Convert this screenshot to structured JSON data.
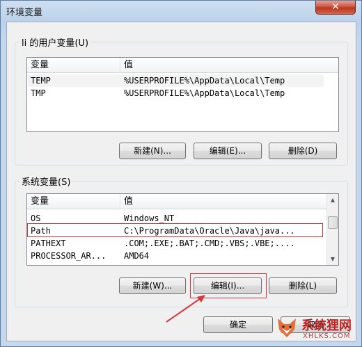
{
  "window": {
    "title": "环境变量",
    "close_glyph": "✕"
  },
  "user_vars": {
    "group_label": "li 的用户变量(U)",
    "columns": [
      "变量",
      "值"
    ],
    "rows": [
      {
        "name": "TEMP",
        "value": "%USERPROFILE%\\AppData\\Local\\Temp"
      },
      {
        "name": "TMP",
        "value": "%USERPROFILE%\\AppData\\Local\\Temp"
      }
    ],
    "buttons": {
      "new": "新建(N)...",
      "edit": "编辑(E)...",
      "delete": "删除(D)"
    }
  },
  "system_vars": {
    "group_label": "系统变量(S)",
    "columns": [
      "变量",
      "值"
    ],
    "rows": [
      {
        "name": "OS",
        "value": "Windows_NT"
      },
      {
        "name": "Path",
        "value": "C:\\ProgramData\\Oracle\\Java\\java..."
      },
      {
        "name": "PATHEXT",
        "value": ".COM;.EXE;.BAT;.CMD;.VBS;.VBE;...."
      },
      {
        "name": "PROCESSOR_AR...",
        "value": "AMD64"
      }
    ],
    "buttons": {
      "new": "新建(W)...",
      "edit": "编辑(I)...",
      "delete": "删除(L)"
    }
  },
  "dialog_buttons": {
    "ok": "确定",
    "cancel": "取消"
  },
  "watermark": {
    "name": "系统狸网",
    "site": "XHLKS.COM",
    "icon": "fox-icon"
  },
  "colors": {
    "highlight_box": "#d8343d",
    "title_gradient": "#bcd2ea"
  }
}
